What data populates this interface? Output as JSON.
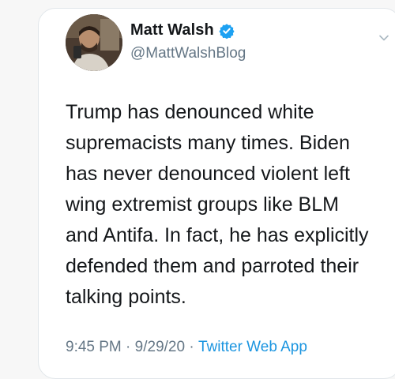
{
  "tweet": {
    "author": {
      "name": "Matt Walsh",
      "handle": "@MattWalshBlog",
      "verified": true
    },
    "text": "Trump has denounced white\nsupremacists many times. Biden\nhas never denounced violent left\nwing extremist groups like BLM\nand Antifa. In fact, he has explicitly\ndefended them and parroted their\ntalking points.",
    "time": "9:45 PM",
    "separator": " · ",
    "date": "9/29/20",
    "source": "Twitter Web App"
  },
  "icons": {
    "verified": "verified-badge-icon",
    "more": "chevron-down-icon"
  },
  "colors": {
    "text": "#14171a",
    "secondary": "#657786",
    "link": "#1b95e0",
    "verified": "#1da1f2"
  }
}
